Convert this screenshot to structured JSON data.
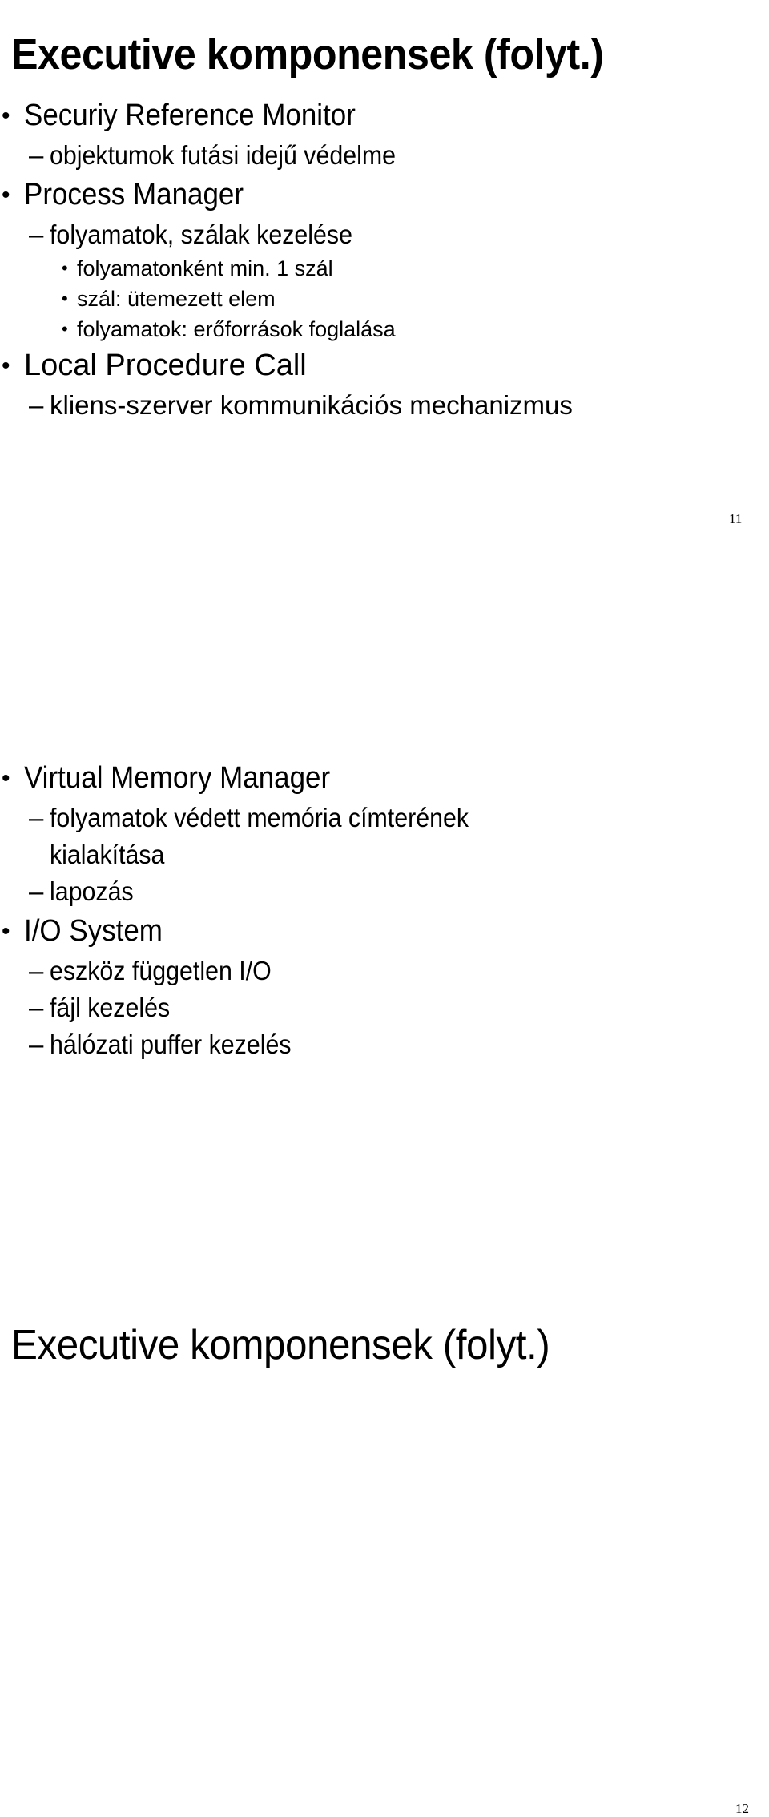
{
  "document": {
    "slides": [
      {
        "id": "slide-11",
        "title": "Executive komponensek (folyt.)",
        "page_number": "11",
        "bullets": [
          {
            "level": 1,
            "marker": "•",
            "text": "Securiy Reference Monitor"
          },
          {
            "level": 2,
            "marker": "–",
            "text": "objektumok futási idejű védelme"
          },
          {
            "level": 1,
            "marker": "•",
            "text": "Process Manager"
          },
          {
            "level": 2,
            "marker": "–",
            "text": "folyamatok, szálak kezelése"
          },
          {
            "level": 3,
            "marker": "•",
            "text": "folyamatonként min. 1 szál"
          },
          {
            "level": 3,
            "marker": "•",
            "text": "szál: ütemezett elem"
          },
          {
            "level": 3,
            "marker": "•",
            "text": "folyamatok: erőforrások foglalása"
          },
          {
            "level": 1,
            "marker": "•",
            "text": "Local Procedure Call"
          },
          {
            "level": 2,
            "marker": "–",
            "text": "kliens-szerver kommunikációs mechanizmus"
          }
        ]
      },
      {
        "id": "slide-12",
        "title": "Executive komponensek (folyt.)",
        "page_number": "12",
        "bullets": [
          {
            "level": 1,
            "marker": "•",
            "text": "Virtual Memory Manager"
          },
          {
            "level": 2,
            "marker": "–",
            "text": "folyamatok védett memória címterének kialakítása"
          },
          {
            "level": 2,
            "marker": "–",
            "text": "lapozás"
          },
          {
            "level": 1,
            "marker": "•",
            "text": "I/O System"
          },
          {
            "level": 2,
            "marker": "–",
            "text": "eszköz független I/O"
          },
          {
            "level": 2,
            "marker": "–",
            "text": "fájl kezelés"
          },
          {
            "level": 2,
            "marker": "–",
            "text": "hálózati puffer kezelés"
          }
        ]
      }
    ]
  }
}
